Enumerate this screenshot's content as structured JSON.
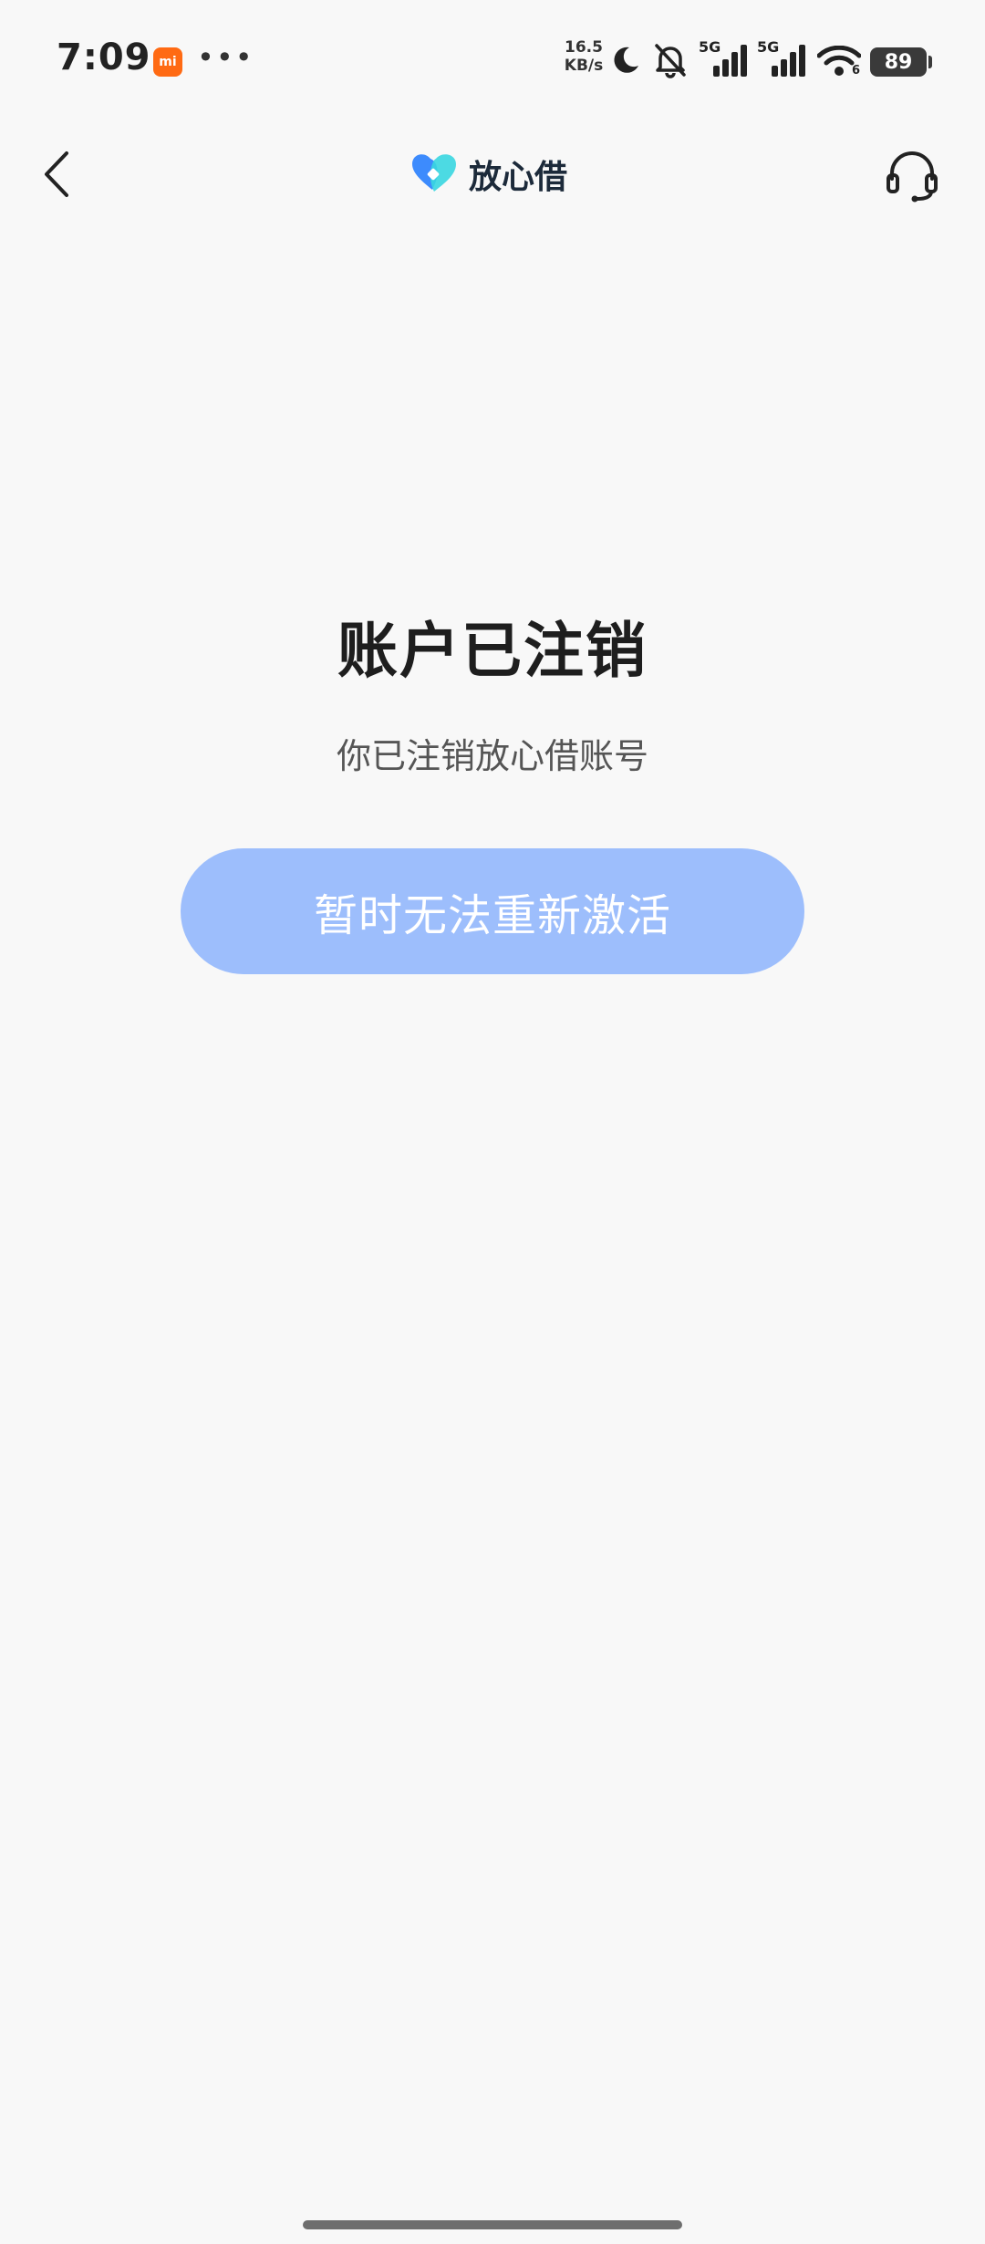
{
  "status_bar": {
    "time": "7:09",
    "mi_badge": "mi",
    "more": "•••",
    "net_speed_value": "16.5",
    "net_speed_unit": "KB/s",
    "sim1_label": "5G",
    "sim2_label": "5G",
    "wifi_label": "6",
    "battery": "89"
  },
  "nav": {
    "brand_name": "放心借"
  },
  "main": {
    "title": "账户已注销",
    "subtitle": "你已注销放心借账号",
    "button_label": "暂时无法重新激活"
  },
  "colors": {
    "background": "#f8f8f8",
    "button_bg": "#9dbefc",
    "button_text": "#ffffff",
    "logo_blue": "#3d8bfd",
    "logo_cyan": "#38d6e0"
  }
}
